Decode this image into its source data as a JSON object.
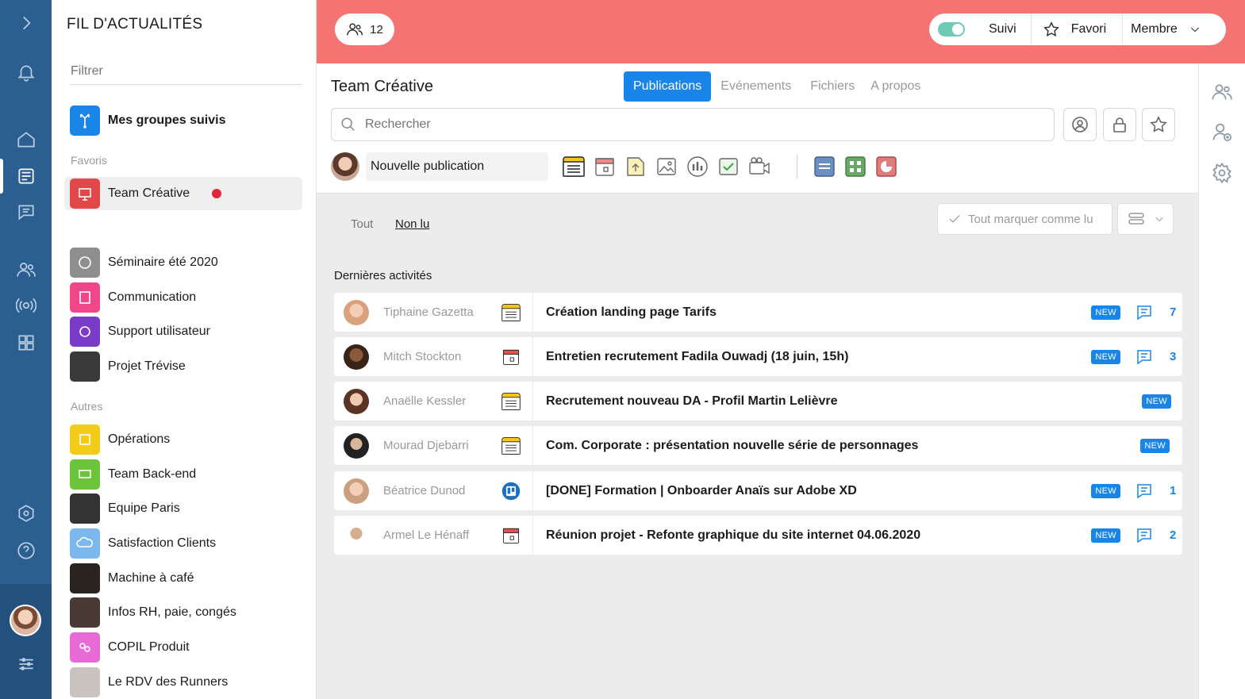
{
  "feed": {
    "title": "FIL D'ACTUALITÉS",
    "filter_placeholder": "Filtrer",
    "followed_groups": "Mes groupes suivis",
    "favorites_section": "Favoris",
    "others_section": "Autres",
    "favorites": [
      {
        "label": "Team Créative",
        "color": "#e24848"
      }
    ],
    "groups_a": [
      {
        "label": "Séminaire été 2020",
        "color": "#8e8e8e"
      },
      {
        "label": "Communication",
        "color": "#f0468a"
      },
      {
        "label": "Support utilisateur",
        "color": "#7a3cc8"
      },
      {
        "label": "Projet Trévise",
        "color": "#3a3a3a"
      }
    ],
    "groups_b": [
      {
        "label": "Opérations",
        "color": "#f3cc19"
      },
      {
        "label": "Team Back-end",
        "color": "#6cc43a"
      },
      {
        "label": "Equipe Paris",
        "color": "#333333"
      },
      {
        "label": "Satisfaction Clients",
        "color": "#7ab8ee"
      },
      {
        "label": "Machine à café",
        "color": "#2a2420"
      },
      {
        "label": "Infos RH, paie, congés",
        "color": "#4a3a36"
      },
      {
        "label": "COPIL Produit",
        "color": "#e86ad6"
      },
      {
        "label": "Le RDV des Runners",
        "color": "#c9c4be"
      }
    ]
  },
  "header": {
    "member_count": "12",
    "follow_label": "Suivi",
    "favorite_label": "Favori",
    "member_label": "Membre",
    "band_color": "#f47373"
  },
  "group": {
    "title": "Team Créative",
    "tabs": [
      "Publications",
      "Evénements",
      "Fichiers",
      "A propos"
    ],
    "search_placeholder": "Rechercher",
    "new_post": "Nouvelle publication"
  },
  "filters": {
    "all": "Tout",
    "unread": "Non lu",
    "mark_all": "Tout marquer comme lu"
  },
  "activities": {
    "title": "Dernières activités",
    "new_badge": "NEW",
    "items": [
      {
        "author": "Tiphaine Gazetta",
        "type": "post",
        "title": "Création landing page Tarifs",
        "comments": "7",
        "avatar": "#d9a27c"
      },
      {
        "author": "Mitch Stockton",
        "type": "event",
        "title": "Entretien recrutement Fadila Ouwadj (18 juin, 15h)",
        "comments": "3",
        "avatar": "#7a4a30"
      },
      {
        "author": "Anaëlle Kessler",
        "type": "post",
        "title": "Recrutement nouveau DA - Profil Martin Lelièvre",
        "comments": "",
        "avatar": "#b07d62"
      },
      {
        "author": "Mourad Djebarri",
        "type": "post",
        "title": "Com. Corporate : présentation nouvelle série de personnages",
        "comments": "",
        "avatar": "#3b3b3b"
      },
      {
        "author": "Béatrice Dunod",
        "type": "trello",
        "title": "[DONE] Formation | Onboarder Anaïs sur Adobe XD",
        "comments": "1",
        "avatar": "#caa07e"
      },
      {
        "author": "Armel Le Hénaff",
        "type": "event",
        "title": "Réunion projet - Refonte graphique du site internet 04.06.2020",
        "comments": "2",
        "avatar": "#4a3a30"
      }
    ]
  }
}
